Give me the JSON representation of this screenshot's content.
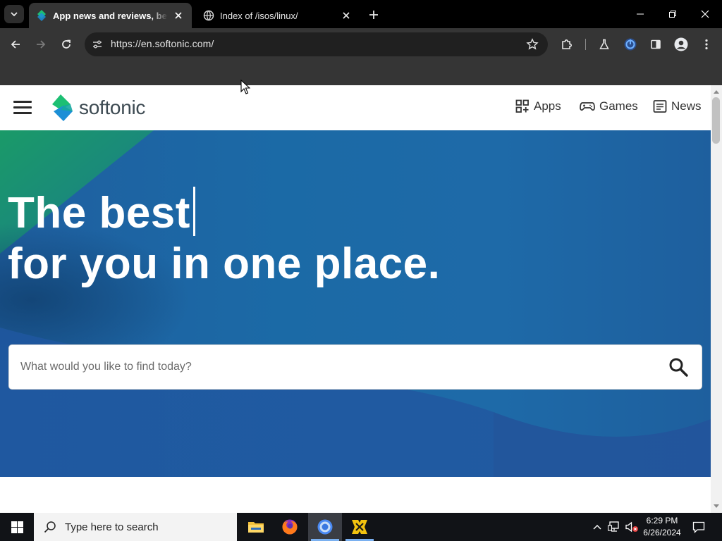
{
  "browser": {
    "tabs": [
      {
        "title": "App news and reviews, best so",
        "active": true
      },
      {
        "title": "Index of /isos/linux/",
        "active": false
      }
    ],
    "url": "https://en.softonic.com/"
  },
  "site": {
    "logo_text": "softonic",
    "nav": [
      {
        "label": "Apps",
        "icon": "apps-grid-icon"
      },
      {
        "label": "Games",
        "icon": "gamepad-icon"
      },
      {
        "label": "News",
        "icon": "news-icon"
      }
    ],
    "hero": {
      "line1": "The best",
      "line2": "for you in one place."
    },
    "search": {
      "placeholder": "What would you like to find today?"
    }
  },
  "taskbar": {
    "search_label": "Type here to search",
    "time": "6:29 PM",
    "date": "6/26/2024"
  },
  "colors": {
    "brand_green": "#1dbf73",
    "brand_blue": "#1c8fd6",
    "hero_blue": "#1b6aa6"
  }
}
